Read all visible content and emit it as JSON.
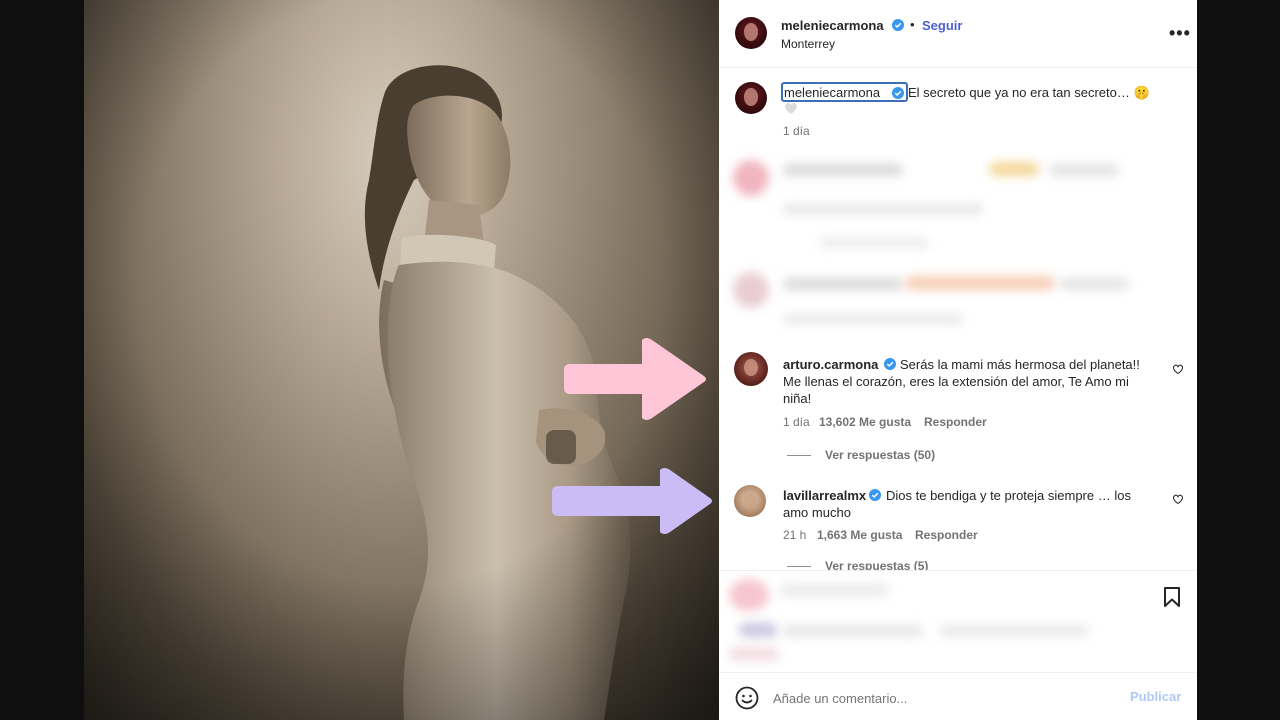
{
  "post": {
    "author": "meleniecarmona",
    "follow_label": "Seguir",
    "separator": "•",
    "location": "Monterrey",
    "more_label": "•••"
  },
  "caption": {
    "username": "meleniecarmona",
    "text": "El secreto que ya no era tan secreto… 🤫",
    "time": "1 día"
  },
  "comments": [
    {
      "username": "arturo.carmona",
      "text_line1": "Serás la mami más hermosa del planeta!!",
      "text_line2": "Me llenas el corazón, eres la extensión del amor, Te Amo mi",
      "text_line3": "niña!",
      "time": "1 día",
      "likes": "13,602 Me gusta",
      "reply_label": "Responder",
      "view_replies": "Ver respuestas (50)"
    },
    {
      "username": "lavillarrealmx",
      "text_line1": "Dios te bendiga y te proteja siempre … los",
      "text_line2": "amo mucho",
      "time": "21 h",
      "likes": "1,663 Me gusta",
      "reply_label": "Responder",
      "view_replies": "Ver respuestas (5)"
    }
  ],
  "composer": {
    "placeholder": "Añade un comentario...",
    "publish_label": "Publicar"
  },
  "colors": {
    "arrow_pink": "#ffc6d8",
    "arrow_lavender": "#cbbcf6",
    "link_blue": "#4c5fd5",
    "verified_blue": "#3897f0",
    "publish_disabled": "#b2c9f5"
  },
  "icons": {
    "verified": "verified-badge-icon",
    "heart": "heart-icon",
    "bookmark": "bookmark-icon",
    "emoji": "emoji-smiley-icon",
    "more": "more-options-icon"
  }
}
